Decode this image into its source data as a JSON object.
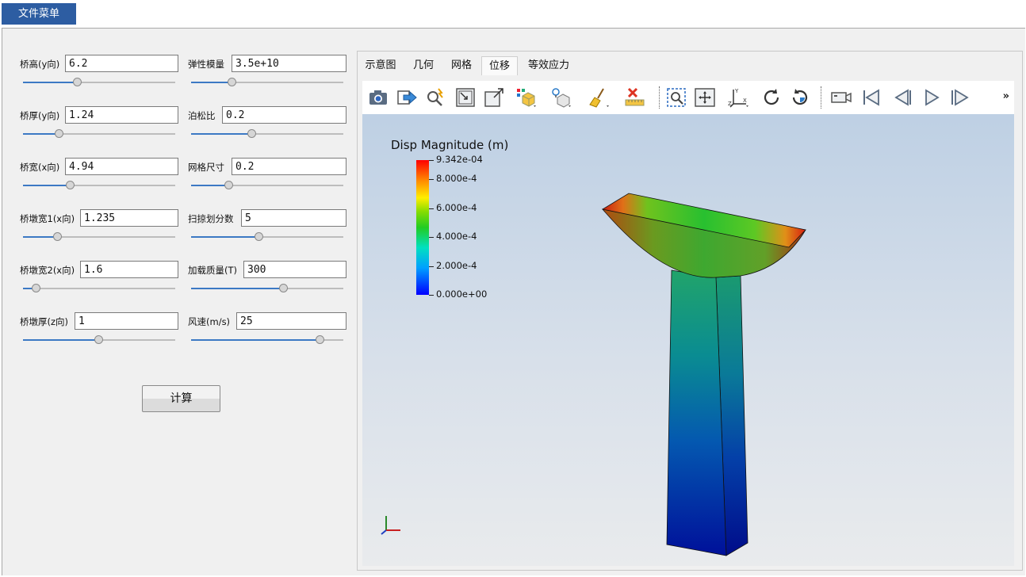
{
  "menu": {
    "file_menu": "文件菜单"
  },
  "params": {
    "left": [
      {
        "label": "桥高(y向)",
        "value": "6.2",
        "slider": 0.36
      },
      {
        "label": "桥厚(y向)",
        "value": "1.24",
        "slider": 0.24
      },
      {
        "label": "桥宽(x向)",
        "value": "4.94",
        "slider": 0.31
      },
      {
        "label": "桥墩宽1(x向)",
        "value": "1.235",
        "slider": 0.23
      },
      {
        "label": "桥墩宽2(x向)",
        "value": "1.6",
        "slider": 0.09
      },
      {
        "label": "桥墩厚(z向)",
        "value": "1",
        "slider": 0.5
      }
    ],
    "right": [
      {
        "label": "弹性模量",
        "value": "3.5e+10",
        "slider": 0.27
      },
      {
        "label": "泊松比",
        "value": "0.2",
        "slider": 0.4
      },
      {
        "label": "网格尺寸",
        "value": "0.2",
        "slider": 0.25
      },
      {
        "label": "扫掠划分数",
        "value": "5",
        "slider": 0.45
      },
      {
        "label": "加载质量(T)",
        "value": "300",
        "slider": 0.61
      },
      {
        "label": "风速(m/s)",
        "value": "25",
        "slider": 0.85
      }
    ]
  },
  "actions": {
    "compute": "计算"
  },
  "tabs": [
    "示意图",
    "几何",
    "网格",
    "位移",
    "等效应力"
  ],
  "active_tab": "位移",
  "toolbar": {
    "icons": [
      "camera-icon",
      "export-icon",
      "probe-icon",
      "select-area-icon",
      "select-cell-icon",
      "representation-icon",
      "light-icon",
      "clear-icon",
      "ruler-icon",
      "zoom-box-icon",
      "fit-view-icon",
      "axes-icon",
      "rotate-cw-icon",
      "rotate-ccw-icon",
      "camera-video-icon",
      "first-frame-icon",
      "prev-frame-icon",
      "play-icon",
      "next-frame-icon"
    ],
    "overflow": "»"
  },
  "legend": {
    "title": "Disp Magnitude (m)",
    "labels": [
      {
        "text": "9.342e-04",
        "value": 0.0009342
      },
      {
        "text": "8.000e-4",
        "value": 0.0008
      },
      {
        "text": "6.000e-4",
        "value": 0.0006
      },
      {
        "text": "4.000e-4",
        "value": 0.0004
      },
      {
        "text": "2.000e-4",
        "value": 0.0002
      },
      {
        "text": "0.000e+00",
        "value": 0
      }
    ],
    "max": 0.0009342
  },
  "colors": {
    "accent": "#2d5da2",
    "slider_fill": "#3c79c4"
  }
}
